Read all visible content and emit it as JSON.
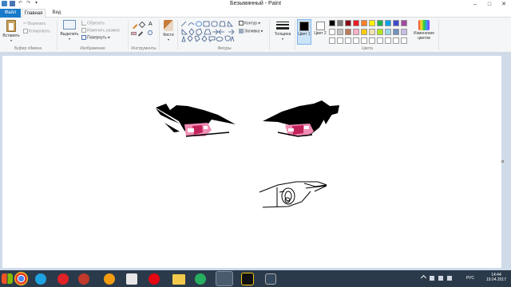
{
  "titlebar": {
    "title": "Безымянный - Paint",
    "quick_access": [
      "save-icon",
      "undo-icon",
      "redo-icon",
      "customize-icon"
    ],
    "minimize": "–",
    "maximize": "□",
    "close": "✕"
  },
  "tabs": {
    "file": "Файл",
    "home": "Главная",
    "view": "Вид"
  },
  "clipboard": {
    "paste": "Вставить",
    "cut": "Вырезать",
    "copy": "Копировать",
    "label": "Буфер обмена"
  },
  "image": {
    "select": "Выделить",
    "crop": "Обрезать",
    "resize": "Изменить размер",
    "rotate": "Повернуть",
    "label": "Изображение"
  },
  "tools": {
    "label": "Инструменты"
  },
  "brushes": {
    "label": "Кисти"
  },
  "shapes": {
    "outline": "Контур",
    "fill": "Заливка",
    "label": "Фигуры"
  },
  "size": {
    "label": "Толщина"
  },
  "colors": {
    "color1": "Цвет 1",
    "color2": "Цвет 2",
    "edit": "Изменение цветов",
    "label": "Цвета",
    "color1_value": "#000000",
    "color2_value": "#ffffff",
    "palette_row1": [
      "#000000",
      "#7f7f7f",
      "#880015",
      "#ed1c24",
      "#ff7f27",
      "#fff200",
      "#22b14c",
      "#00a2e8",
      "#3f48cc",
      "#a349a4"
    ],
    "palette_row2": [
      "#ffffff",
      "#c3c3c3",
      "#b97a57",
      "#ffaec9",
      "#ffc90e",
      "#efe4b0",
      "#b5e61d",
      "#99d9ea",
      "#7092be",
      "#c8bfe7"
    ]
  },
  "taskbar": {
    "apps": [
      "windows-start",
      "chrome-icon",
      "ie-icon",
      "opera-icon",
      "app-icon",
      "yandex-icon",
      "yandex-browser-icon",
      "explorer-icon",
      "app-green-icon",
      "paint-icon",
      "star-icon",
      "app-icon-2"
    ],
    "lang": "РУС",
    "time": "14:44",
    "date": "19.04.2017"
  }
}
